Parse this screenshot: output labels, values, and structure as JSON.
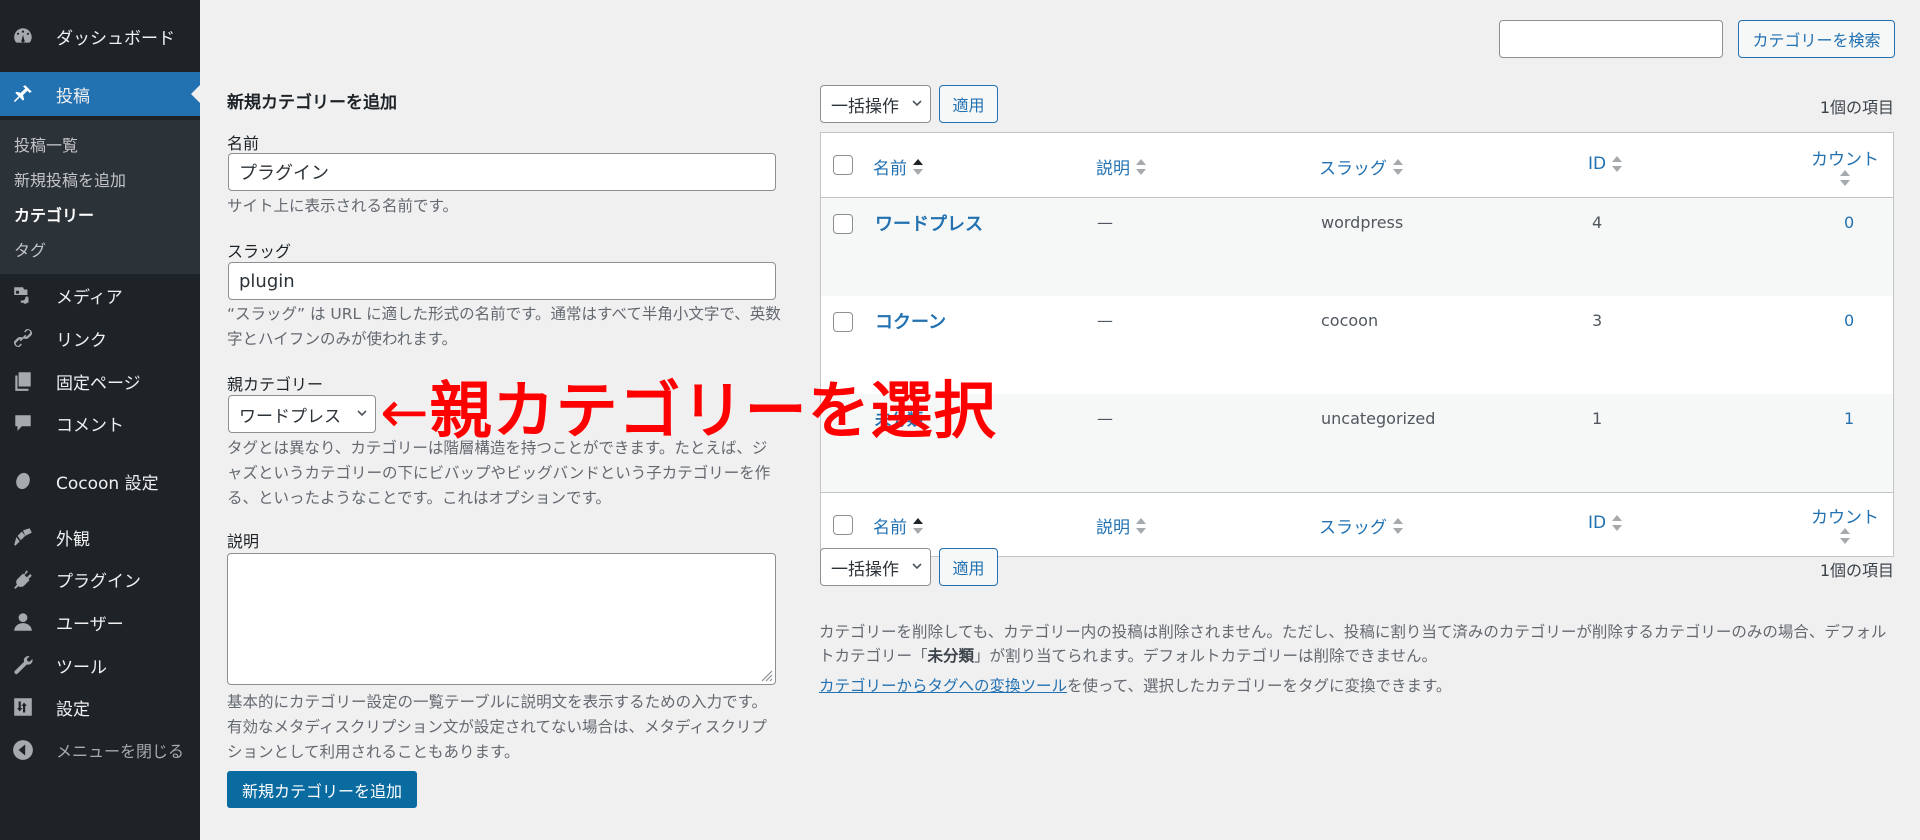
{
  "sidebar": {
    "items": [
      {
        "label": "ダッシュボード",
        "icon": "dashboard-icon"
      },
      {
        "label": "投稿",
        "icon": "pin-icon",
        "active": true
      },
      {
        "label": "メディア",
        "icon": "media-icon"
      },
      {
        "label": "リンク",
        "icon": "link-icon"
      },
      {
        "label": "固定ページ",
        "icon": "pages-icon"
      },
      {
        "label": "コメント",
        "icon": "comment-icon"
      },
      {
        "label": "Cocoon 設定",
        "icon": "cocoon-icon"
      },
      {
        "label": "外観",
        "icon": "brush-icon"
      },
      {
        "label": "プラグイン",
        "icon": "plugin-icon"
      },
      {
        "label": "ユーザー",
        "icon": "user-icon"
      },
      {
        "label": "ツール",
        "icon": "wrench-icon"
      },
      {
        "label": "設定",
        "icon": "settings-icon"
      }
    ],
    "submenu": [
      "投稿一覧",
      "新規投稿を追加",
      "カテゴリー",
      "タグ"
    ],
    "submenu_current": "カテゴリー",
    "collapse_label": "メニューを閉じる"
  },
  "form": {
    "title": "新規カテゴリーを追加",
    "name_label": "名前",
    "name_value": "プラグイン",
    "name_help": "サイト上に表示される名前です。",
    "slug_label": "スラッグ",
    "slug_value": "plugin",
    "slug_help": "“スラッグ” は URL に適した形式の名前です。通常はすべて半角小文字で、英数字とハイフンのみが使われます。",
    "parent_label": "親カテゴリー",
    "parent_value": "ワードプレス",
    "parent_help": "タグとは異なり、カテゴリーは階層構造を持つことができます。たとえば、ジャズというカテゴリーの下にビバップやビッグバンドという子カテゴリーを作る、といったようなことです。これはオプションです。",
    "description_label": "説明",
    "description_value": "",
    "description_help": "基本的にカテゴリー設定の一覧テーブルに説明文を表示するための入力です。有効なメタディスクリプション文が設定されてない場合は、メタディスクリプションとして利用されることもあります。",
    "submit_label": "新規カテゴリーを追加"
  },
  "annotation": {
    "arrow": "←",
    "text": "親カテゴリーを選択",
    "color": "#ff0000"
  },
  "search": {
    "value": "",
    "button_label": "カテゴリーを検索"
  },
  "bulk": {
    "select_label": "一括操作",
    "apply_label": "適用",
    "item_count": "1個の項目"
  },
  "table": {
    "columns": [
      "名前",
      "説明",
      "スラッグ",
      "ID",
      "カウント"
    ],
    "sorted_column": "名前",
    "rows": [
      {
        "name": "ワードプレス",
        "description": "—",
        "slug": "wordpress",
        "id": "4",
        "count": "0",
        "checkbox": true
      },
      {
        "name": "コクーン",
        "description": "—",
        "slug": "cocoon",
        "id": "3",
        "count": "0",
        "checkbox": true
      },
      {
        "name": "未分類",
        "description": "—",
        "slug": "uncategorized",
        "id": "1",
        "count": "1",
        "checkbox": false
      }
    ]
  },
  "notes": {
    "delete_note_1": "カテゴリーを削除しても、カテゴリー内の投稿は削除されません。ただし、投稿に割り当て済みのカテゴリーが削除するカテゴリーのみの場合、デフォルトカテゴリー「",
    "delete_note_bold": "未分類",
    "delete_note_2": "」が割り当てられます。デフォルトカテゴリーは削除できません。",
    "converter_link": "カテゴリーからタグへの変換ツール",
    "converter_rest": "を使って、選択したカテゴリーをタグに変換できます。"
  },
  "colors": {
    "sidebar_bg": "#1d2327",
    "submenu_bg": "#2c3338",
    "accent": "#2271b1",
    "primary_button": "#0a6ba0",
    "page_bg": "#f0f0f1"
  }
}
